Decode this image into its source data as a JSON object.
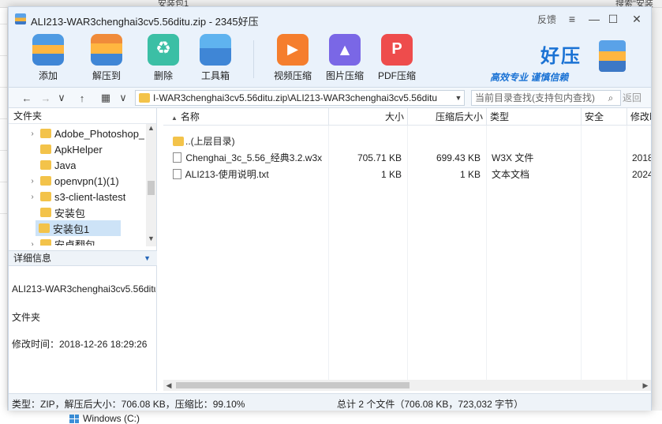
{
  "background": {
    "crumb": "安装包1",
    "right_text": "搜索\"安装",
    "drive": "Windows (C:)"
  },
  "window": {
    "title": "ALI213-WAR3chenghai3cv5.56ditu.zip - 2345好压",
    "feedback": "反馈",
    "controls": {
      "menu": "≡",
      "minimize": "—",
      "maximize": "☐",
      "close": "✕"
    }
  },
  "toolbar": {
    "add": "添加",
    "extract": "解压到",
    "delete": "删除",
    "toolbox": "工具箱",
    "video": "视频压缩",
    "image": "图片压缩",
    "pdf": "PDF压缩"
  },
  "brand": {
    "name": "好压",
    "slogan": "高效专业 谨慎信赖"
  },
  "address": {
    "path": "I-WAR3chenghai3cv5.56ditu.zip\\ALI213-WAR3chenghai3cv5.56ditu",
    "search_placeholder": "当前目录查找(支持包内查找)",
    "search_button": "返回"
  },
  "left_pane": {
    "header": "文件夹",
    "tree": [
      {
        "label": "Adobe_Photoshop_",
        "has_children": true
      },
      {
        "label": "ApkHelper",
        "has_children": false
      },
      {
        "label": "Java",
        "has_children": false
      },
      {
        "label": "openvpn(1)(1)",
        "has_children": true
      },
      {
        "label": "s3-client-lastest",
        "has_children": true
      },
      {
        "label": "安装包",
        "has_children": false
      },
      {
        "label": "安装包1",
        "has_children": false,
        "selected": true
      },
      {
        "label": "安卓翻包",
        "has_children": true
      }
    ],
    "detail_header": "详细信息",
    "detail_name": "ALI213-WAR3chenghai3cv5.56ditu",
    "detail_type": "文件夹",
    "detail_modified": "修改时间：2018-12-26 18:29:26"
  },
  "columns": {
    "name": "名称",
    "size": "大小",
    "packed": "压缩后大小",
    "type": "类型",
    "security": "安全",
    "modified": "修改时间"
  },
  "files": [
    {
      "icon": "folder",
      "name": "..(上层目录)",
      "size": "",
      "packed": "",
      "type": "",
      "security": "",
      "modified": ""
    },
    {
      "icon": "doc",
      "name": "Chenghai_3c_5.56_经典3.2.w3x",
      "size": "705.71 KB",
      "packed": "699.43 KB",
      "type": "W3X 文件",
      "security": "",
      "modified": "2018-"
    },
    {
      "icon": "doc",
      "name": "ALI213-使用说明.txt",
      "size": "1 KB",
      "packed": "1 KB",
      "type": "文本文档",
      "security": "",
      "modified": "2024-"
    }
  ],
  "status": {
    "left": "类型：ZIP，解压后大小：706.08 KB，压缩比：99.10%",
    "right": "总计 2 个文件（706.08 KB，723,032 字节）"
  }
}
